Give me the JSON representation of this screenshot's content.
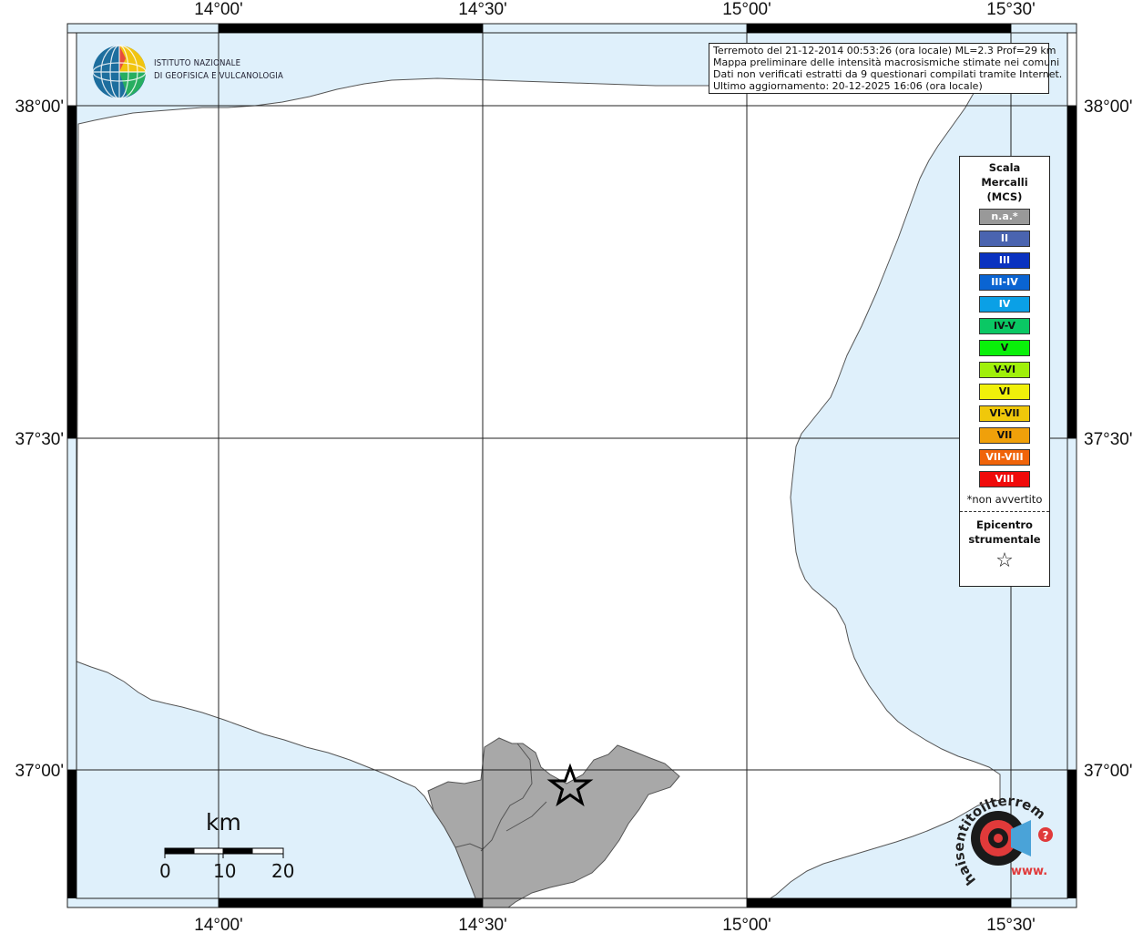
{
  "map": {
    "lon_labels": [
      "14°00'",
      "14°30'",
      "15°00'",
      "15°30'"
    ],
    "lat_labels": [
      "38°00'",
      "37°30'",
      "37°00'"
    ],
    "colors": {
      "sea": "#dff0fb",
      "land": "#ffffff",
      "affected_area": "#a8a8a8",
      "coast": "#555555",
      "grid": "#000000"
    },
    "epicenter_icon": "star-icon"
  },
  "info": {
    "line1": "Terremoto del 21-12-2014 00:53:26 (ora locale) ML=2.3 Prof=29 km",
    "line2": "Mappa preliminare delle intensità macrosismiche stimate nei comuni",
    "line3": "Dati non verificati estratti da 9 questionari compilati tramite Internet.",
    "line4": "Ultimo aggiornamento: 20-12-2025 16:06 (ora locale)"
  },
  "legend": {
    "title1": "Scala",
    "title2": "Mercalli",
    "title3": "(MCS)",
    "items": [
      {
        "label": "n.a.*",
        "color": "#999999",
        "dark": false
      },
      {
        "label": "II",
        "color": "#4a64b0",
        "dark": false
      },
      {
        "label": "III",
        "color": "#0a32c0",
        "dark": false
      },
      {
        "label": "III-IV",
        "color": "#0a64d2",
        "dark": false
      },
      {
        "label": "IV",
        "color": "#0aa0e6",
        "dark": false
      },
      {
        "label": "IV-V",
        "color": "#0ac864",
        "dark": true
      },
      {
        "label": "V",
        "color": "#0af00a",
        "dark": true
      },
      {
        "label": "V-VI",
        "color": "#a0f00a",
        "dark": true
      },
      {
        "label": "VI",
        "color": "#f0f00a",
        "dark": true
      },
      {
        "label": "VI-VII",
        "color": "#f0c80a",
        "dark": true
      },
      {
        "label": "VII",
        "color": "#f0a00a",
        "dark": true
      },
      {
        "label": "VII-VIII",
        "color": "#f0640a",
        "dark": false
      },
      {
        "label": "VIII",
        "color": "#f00a0a",
        "dark": false
      }
    ],
    "note": "*non avvertito",
    "epicentro1": "Epicentro",
    "epicentro2": "strumentale",
    "star_icon": "star-icon",
    "star_glyph": "☆"
  },
  "logo": {
    "line1": "ISTITUTO NAZIONALE",
    "line2": "DI GEOFISICA E VULCANOLOGIA"
  },
  "scale": {
    "unit": "km",
    "ticks": [
      "0",
      "10",
      "20"
    ]
  },
  "hsit": {
    "arc_text": "haisentitoilterremoto.it",
    "www": "www.",
    "question": "?"
  }
}
